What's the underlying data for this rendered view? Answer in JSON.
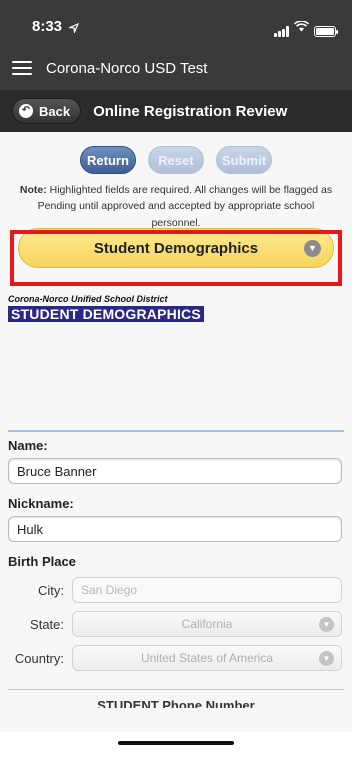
{
  "status_bar": {
    "time": "8:33",
    "location_icon": "location-arrow-icon",
    "signal_icon": "cellular-signal-icon",
    "wifi_icon": "wifi-icon",
    "battery_icon": "battery-icon",
    "battery_level": 0.9
  },
  "app_bar": {
    "menu_icon": "hamburger-menu-icon",
    "title": "Corona-Norco USD Test"
  },
  "nav_bar": {
    "back_label": "Back",
    "back_icon": "back-arrow-icon",
    "title": "Online Registration Review"
  },
  "actions": {
    "return_label": "Return",
    "reset_label": "Reset",
    "submit_label": "Submit"
  },
  "note": {
    "prefix": "Note:",
    "text": " Highlighted fields are required. All changes will be flagged as Pending until approved and accepted by appropriate school personnel."
  },
  "section": {
    "label": "Student Demographics",
    "chevron_icon": "chevron-down-icon"
  },
  "district": {
    "name": "Corona-Norco Unified School District",
    "heading": "STUDENT DEMOGRAPHICS"
  },
  "form": {
    "name_label": "Name:",
    "name_value": "Bruce Banner",
    "nickname_label": "Nickname:",
    "nickname_value": "Hulk",
    "birth_place_label": "Birth Place",
    "city_label": "City:",
    "city_value": "San Diego",
    "state_label": "State:",
    "state_value": "California",
    "country_label": "Country:",
    "country_value": "United States of America",
    "phone_heading": "STUDENT Phone Number"
  },
  "colors": {
    "app_bar": "#3a3a3a",
    "nav_bar": "#2b2b2b",
    "primary_button": "#3c5f96",
    "section_button": "#f6d560",
    "highlight_border": "#e41919",
    "heading_bg": "#2a2a86"
  }
}
